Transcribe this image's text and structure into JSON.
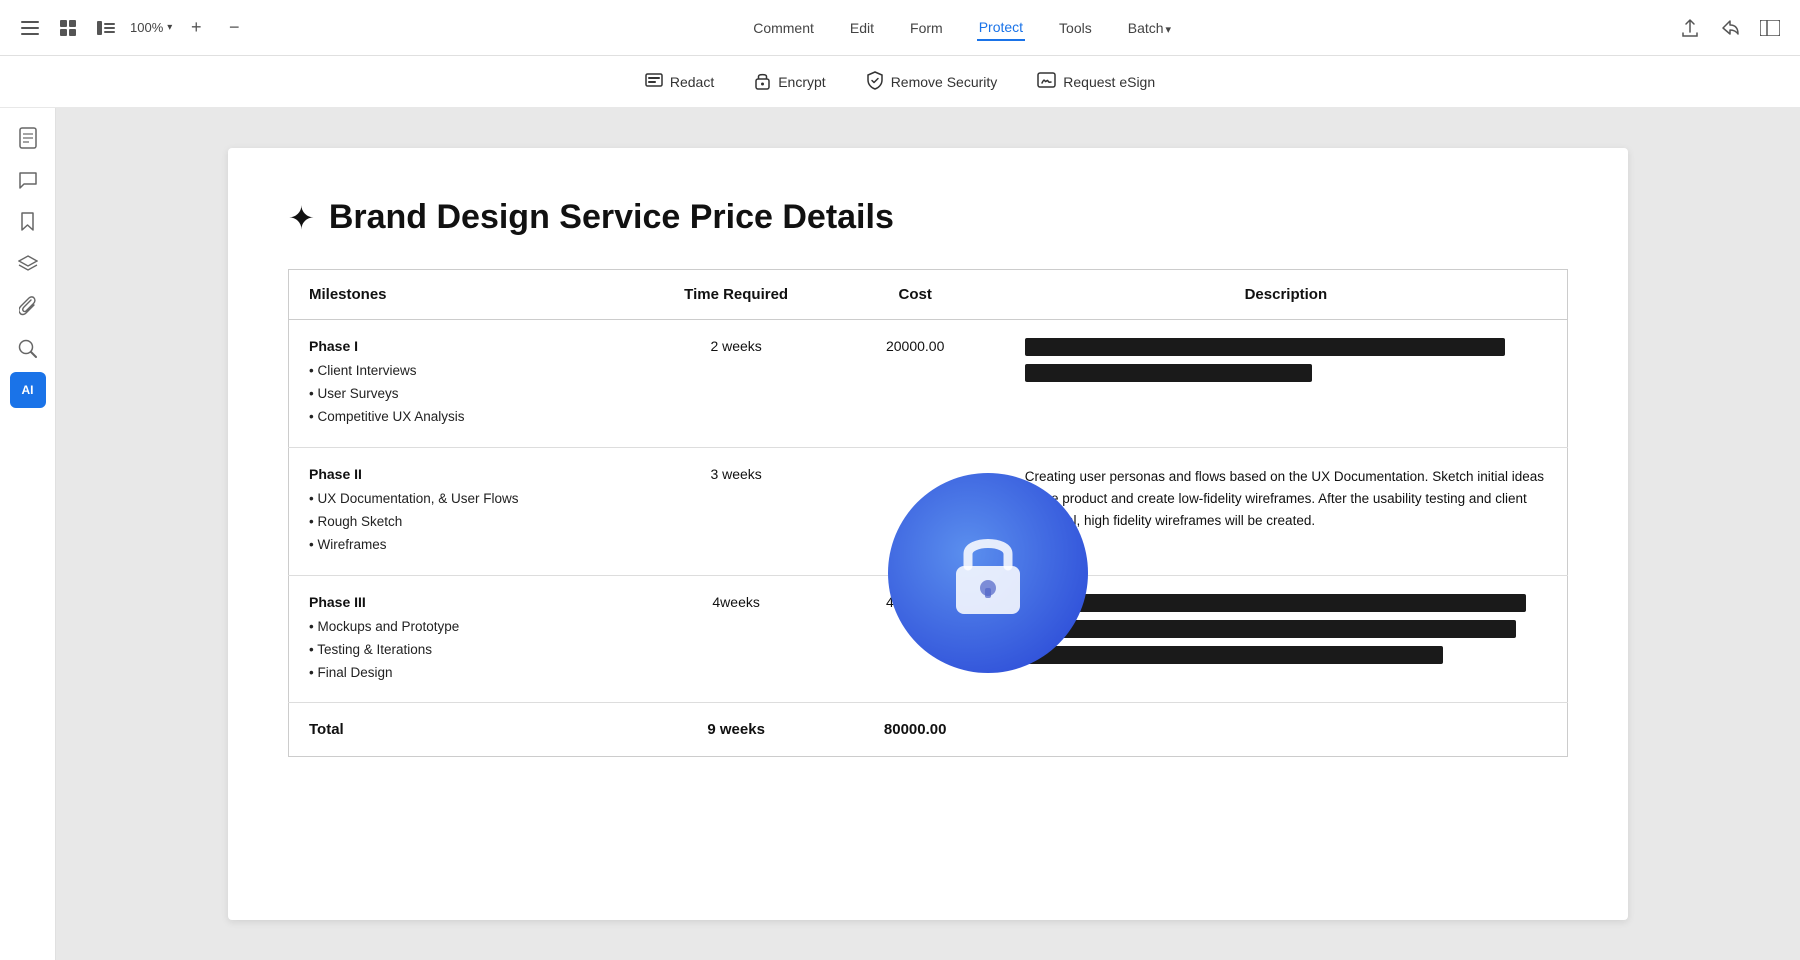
{
  "topToolbar": {
    "zoom": "100%",
    "navItems": [
      {
        "label": "Comment",
        "active": false
      },
      {
        "label": "Edit",
        "active": false
      },
      {
        "label": "Form",
        "active": false
      },
      {
        "label": "Protect",
        "active": true
      },
      {
        "label": "Tools",
        "active": false
      },
      {
        "label": "Batch",
        "active": false,
        "hasArrow": true
      }
    ]
  },
  "subToolbar": {
    "items": [
      {
        "label": "Redact",
        "icon": "redact"
      },
      {
        "label": "Encrypt",
        "icon": "lock"
      },
      {
        "label": "Remove Security",
        "icon": "shield"
      },
      {
        "label": "Request eSign",
        "icon": "sign"
      }
    ]
  },
  "sidebar": {
    "icons": [
      {
        "name": "page-icon",
        "symbol": "☐"
      },
      {
        "name": "comment-icon",
        "symbol": "💬"
      },
      {
        "name": "bookmark-icon",
        "symbol": "🔖"
      },
      {
        "name": "layers-icon",
        "symbol": "⊞"
      },
      {
        "name": "attachment-icon",
        "symbol": "📎"
      },
      {
        "name": "search-icon",
        "symbol": "🔍"
      },
      {
        "name": "ai-icon",
        "symbol": "AI",
        "active": true
      }
    ]
  },
  "document": {
    "title": "Brand Design Service Price Details",
    "table": {
      "headers": [
        "Milestones",
        "Time Required",
        "Cost",
        "Description"
      ],
      "phases": [
        {
          "name": "Phase I",
          "items": [
            "• Client Interviews",
            "• User Surveys",
            "• Competitive UX Analysis"
          ],
          "time": "2 weeks",
          "cost": "20000.00",
          "description": "redacted"
        },
        {
          "name": "Phase II",
          "items": [
            "• UX Documentation, & User Flows",
            "• Rough Sketch",
            "• Wireframes"
          ],
          "time": "3 weeks",
          "cost": "",
          "description": "Creating user personas and flows based on the UX Documentation. Sketch initial ideas of the product and create low-fidelity wireframes. After the usability testing and client approval, high fidelity wireframes will be created."
        },
        {
          "name": "Phase III",
          "items": [
            "• Mockups and Prototype",
            "• Testing & Iterations",
            "• Final Design"
          ],
          "time": "4weeks",
          "cost": "40000.00",
          "description": "redacted"
        }
      ],
      "total": {
        "label": "Total",
        "time": "9 weeks",
        "cost": "80000.00"
      }
    }
  }
}
